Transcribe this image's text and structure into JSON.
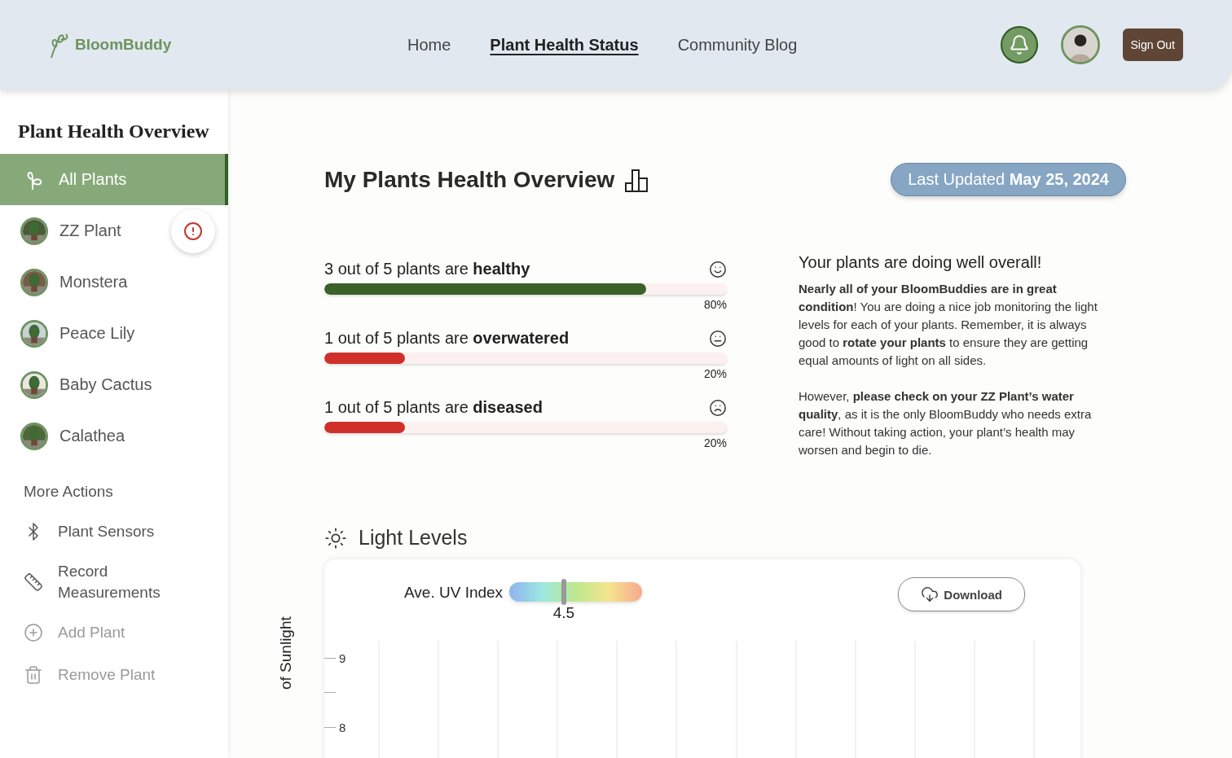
{
  "header": {
    "logo": "BloomBuddy",
    "nav": [
      {
        "label": "Home",
        "selected": false
      },
      {
        "label": "Plant Health Status",
        "selected": true
      },
      {
        "label": "Community Blog",
        "selected": false
      }
    ],
    "sign_out": "Sign Out"
  },
  "sidebar": {
    "title": "Plant Health Overview",
    "all_plants": {
      "label": "All Plants",
      "selected": true
    },
    "plants": [
      {
        "name": "ZZ Plant",
        "alert": true
      },
      {
        "name": "Monstera",
        "alert": false
      },
      {
        "name": "Peace Lily",
        "alert": false
      },
      {
        "name": "Baby Cactus",
        "alert": false
      },
      {
        "name": "Calathea",
        "alert": false
      }
    ],
    "actions_heading": "More Actions",
    "actions": [
      {
        "kind": "sensors",
        "label": "Plant Sensors",
        "disabled": false
      },
      {
        "kind": "measure",
        "label": "Record Measurements",
        "disabled": false
      },
      {
        "kind": "add",
        "label": "Add Plant",
        "disabled": true
      },
      {
        "kind": "remove",
        "label": "Remove Plant",
        "disabled": true
      }
    ]
  },
  "overview": {
    "title": "My Plants Health Overview",
    "last_updated": "Last Updated **May 25, 2024**",
    "stats": [
      {
        "text": "3 out of 5 plants are **healthy**",
        "kind": "happy",
        "color": "#3b6129",
        "level": 0.8,
        "reading": "80%"
      },
      {
        "text": "1 out of 5 plants are **overwatered**",
        "kind": "neutral",
        "color": "#d0302a",
        "level": 0.2,
        "reading": "20%"
      },
      {
        "text": "1 out of 5 plants are **diseased**",
        "kind": "sad",
        "color": "#d0302a",
        "level": 0.2,
        "reading": "20%"
      }
    ],
    "summary_title": "Your plants are doing well overall!",
    "summary": [
      "**Nearly all of your BloomBuddies are in great condition**! You are doing a nice job monitoring the light levels for each of your plants. Remember, it is always good to **rotate your plants** to ensure they are getting equal amounts of light on all sides.",
      "However, **please check on your ZZ Plant’s water quality**, as it is the only BloomBuddy who needs extra care! Without taking action, your plant’s health may worsen and begin to die."
    ]
  },
  "light_levels": {
    "title": "Light Levels",
    "uv_label": "Ave. UV Index",
    "uv": {
      "level": 0.41,
      "reading": "4.5"
    },
    "download": "Download",
    "y_ticks": [
      "9",
      "8"
    ],
    "y_label": "of Sunlight"
  }
}
